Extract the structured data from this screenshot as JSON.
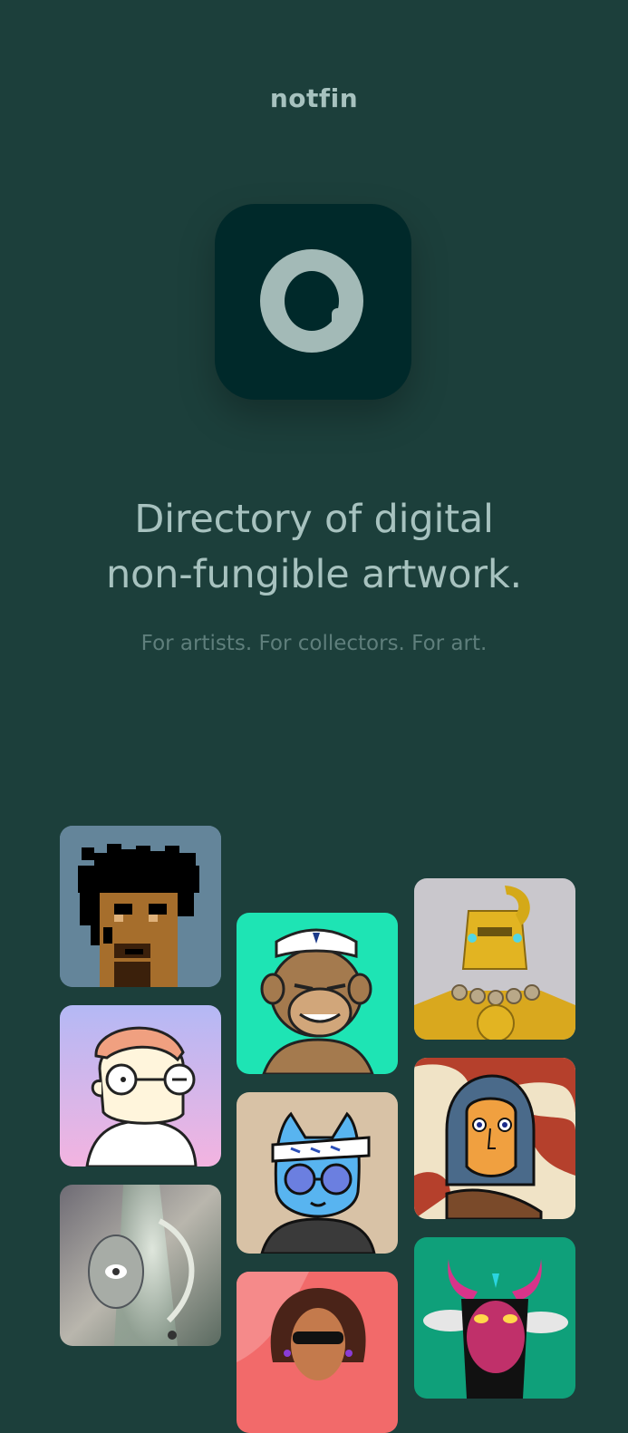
{
  "brand": {
    "logo_text": "notfin"
  },
  "hero": {
    "headline_line1": "Directory of digital",
    "headline_line2": "non-fungible artwork.",
    "tagline": "For artists. For collectors. For art."
  },
  "colors": {
    "background": "#1c3f3b",
    "app_icon_bg": "#00292a",
    "accent_text": "#a7c2bf",
    "muted_text": "#5f7f7c"
  },
  "gallery": {
    "tiles": [
      {
        "name": "pixel-punk",
        "icon": "pixel-avatar"
      },
      {
        "name": "glasses-cartoon",
        "icon": "cartoon-avatar"
      },
      {
        "name": "surreal-face",
        "icon": "abstract-art"
      },
      {
        "name": "sailor-ape",
        "icon": "ape-avatar"
      },
      {
        "name": "blue-cat",
        "icon": "cat-avatar"
      },
      {
        "name": "woman-sunglasses",
        "icon": "woman-avatar"
      },
      {
        "name": "gold-robot",
        "icon": "robot-art"
      },
      {
        "name": "orange-face",
        "icon": "illustrated-face"
      },
      {
        "name": "horned-demon",
        "icon": "demon-art"
      }
    ]
  }
}
